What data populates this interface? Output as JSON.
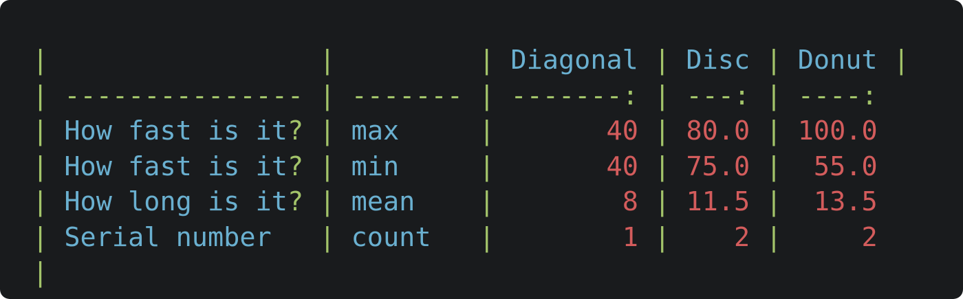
{
  "table": {
    "header": {
      "col1": "",
      "col2": "",
      "col3": "Diagonal",
      "col4": "Disc",
      "col5": "Donut"
    },
    "separator": {
      "col1": "---------------",
      "col2": "-------",
      "col3": "-------:",
      "col4": "---:",
      "col5": "----:"
    },
    "rows": [
      {
        "label": "How fast is it",
        "punct": "?",
        "stat": "max",
        "diagonal": "40",
        "disc": "80.0",
        "donut": "100.0"
      },
      {
        "label": "How fast is it",
        "punct": "?",
        "stat": "min",
        "diagonal": "40",
        "disc": "75.0",
        "donut": "55.0"
      },
      {
        "label": "How long is it",
        "punct": "?",
        "stat": "mean",
        "diagonal": "8",
        "disc": "11.5",
        "donut": "13.5"
      },
      {
        "label": "Serial number",
        "punct": "",
        "stat": "count",
        "diagonal": "1",
        "disc": "2",
        "donut": "2"
      }
    ],
    "trailing_pipe": "|"
  },
  "colors": {
    "background": "#191b1d",
    "pipe": "#a3c46a",
    "text": "#6ab0d0",
    "number": "#d35c5c"
  }
}
